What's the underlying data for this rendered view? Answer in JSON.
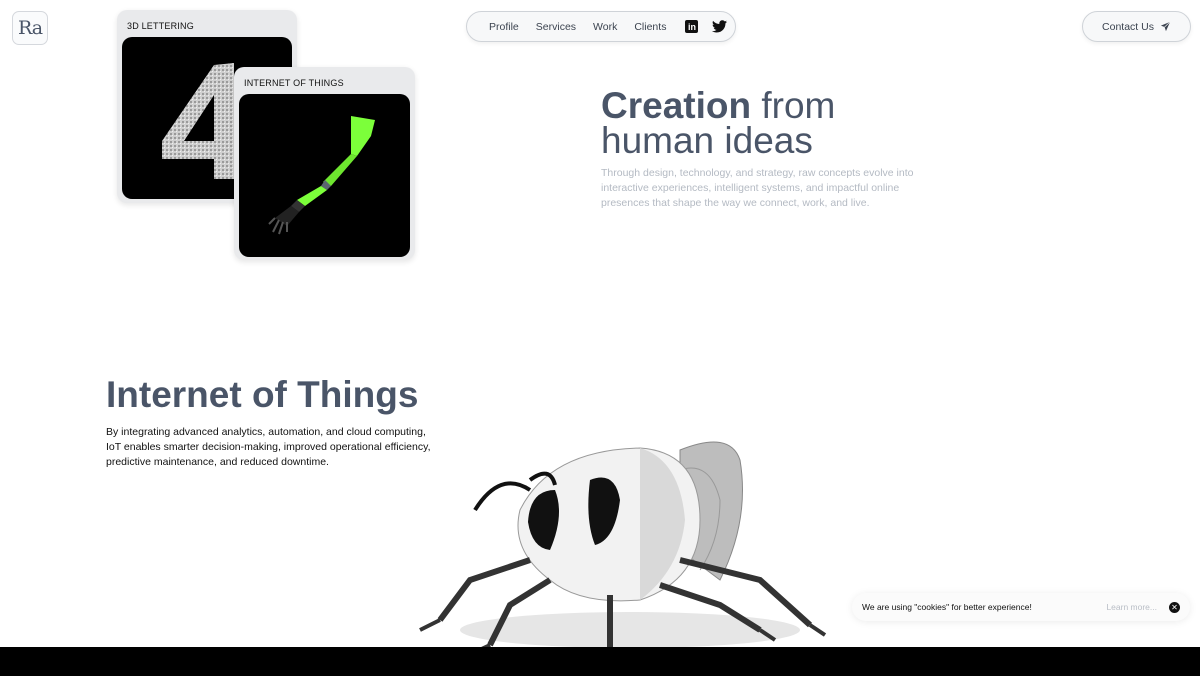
{
  "logo": {
    "text": "Ra"
  },
  "nav": {
    "items": [
      "Profile",
      "Services",
      "Work",
      "Clients"
    ],
    "linkedin_icon": "linkedin-icon",
    "twitter_icon": "twitter-icon"
  },
  "contact": {
    "label": "Contact Us",
    "icon": "paper-plane-icon"
  },
  "cards": [
    {
      "label": "3D LETTERING"
    },
    {
      "label": "INTERNET OF THINGS"
    }
  ],
  "hero": {
    "title_bold": "Creation",
    "title_rest_1": " from",
    "title_line2": "human ideas",
    "description": "Through design, technology, and strategy, raw concepts evolve into interactive experiences, intelligent systems, and impactful online presences that shape the way we connect, work, and live."
  },
  "iot": {
    "title": "Internet of Things",
    "description": "By integrating advanced analytics, automation, and cloud computing, IoT enables smarter decision-making, improved operational efficiency, predictive maintenance, and reduced downtime."
  },
  "cookie": {
    "text": "We are using \"cookies\" for better experience!",
    "more": "Learn more...",
    "close_icon": "close-icon"
  },
  "colors": {
    "heading": "#4a5568",
    "muted": "#b4bac3",
    "accent_green": "#7cff3a"
  }
}
